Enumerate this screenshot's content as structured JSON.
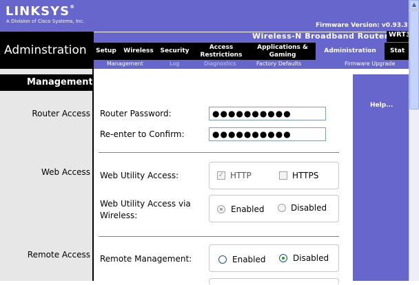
{
  "brand": {
    "logo": "LINKSYS",
    "tagline": "A Division of Cisco Systems, Inc."
  },
  "firmware": "Firmware Version: v0.93.3",
  "product_name": "Wireless-N Broadband Router",
  "model": "WRT3",
  "section_title": "Adminstration",
  "nav": [
    {
      "label": "Setup"
    },
    {
      "label": "Wireless"
    },
    {
      "label": "Security"
    },
    {
      "label": "Access Restrictions"
    },
    {
      "label": "Applications & Gaming"
    },
    {
      "label": "Administration"
    },
    {
      "label": "Stat"
    }
  ],
  "subnav": [
    {
      "label": "Management"
    },
    {
      "label": "Log"
    },
    {
      "label": "Diagnostics"
    },
    {
      "label": "Factory Defaults"
    },
    {
      "label": "Firmware Upgrade"
    }
  ],
  "left": {
    "header": "Management",
    "router_access": "Router Access",
    "web_access": "Web Access",
    "remote_access": "Remote Access"
  },
  "router_access": {
    "password_label": "Router Password:",
    "password_value": "●●●●●●●●●●",
    "confirm_label": "Re-enter to Confirm:",
    "confirm_value": "●●●●●●●●●●"
  },
  "web_access": {
    "utility_label": "Web Utility Access:",
    "http": "HTTP",
    "https": "HTTPS",
    "wireless_label_1": "Web Utility Access via",
    "wireless_label_2": "Wireless:",
    "enabled": "Enabled",
    "disabled": "Disabled"
  },
  "remote_access": {
    "mgmt_label": "Remote Management:",
    "enabled": "Enabled",
    "disabled": "Disabled"
  },
  "help": "Help...",
  "colors": {
    "brand_purple": "#6666cc",
    "black": "#000000",
    "left_gray": "#e7e7e7"
  }
}
